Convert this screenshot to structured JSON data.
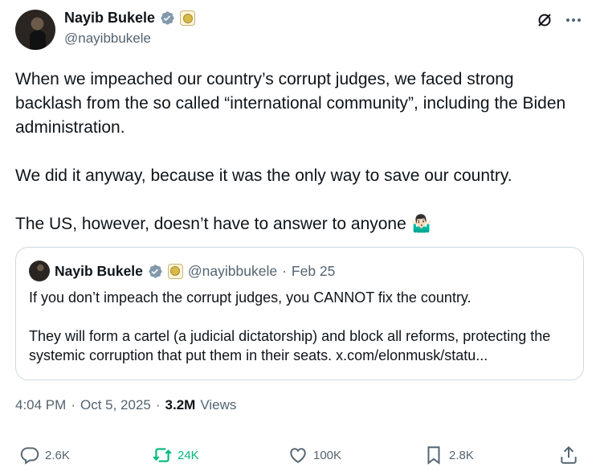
{
  "author": {
    "name": "Nayib Bukele",
    "handle": "@nayibbukele"
  },
  "post": {
    "paragraphs": [
      "When we impeached our country’s corrupt judges, we faced strong backlash from the so called “international community”, including the Biden administration.",
      "We did it anyway, because it was the only way to save our country.",
      "The US, however, doesn’t have to answer to anyone 🤷🏻‍♂️"
    ]
  },
  "quote": {
    "name": "Nayib Bukele",
    "handle": "@nayibbukele",
    "separator": "·",
    "date": "Feb 25",
    "paragraphs": [
      "If you don’t impeach the corrupt judges, you CANNOT fix the country.",
      "They will form a cartel (a judicial dictatorship) and block all reforms, protecting the systemic corruption that put them in their seats. x.com/elonmusk/statu..."
    ]
  },
  "meta": {
    "time": "4:04 PM",
    "sep1": "·",
    "date": "Oct 5, 2025",
    "sep2": "·",
    "views_count": "3.2M",
    "views_label": "Views"
  },
  "actions": {
    "replies": "2.6K",
    "reposts": "24K",
    "likes": "100K",
    "bookmarks": "2.8K"
  },
  "icons": [
    "verified-icon",
    "government-badge-icon",
    "grok-icon",
    "more-icon",
    "reply-icon",
    "repost-icon",
    "like-icon",
    "bookmark-icon",
    "share-icon"
  ],
  "colors": {
    "verified": "#1d9bf0",
    "repost_active": "#00ba7c",
    "secondary_text": "#536471"
  }
}
